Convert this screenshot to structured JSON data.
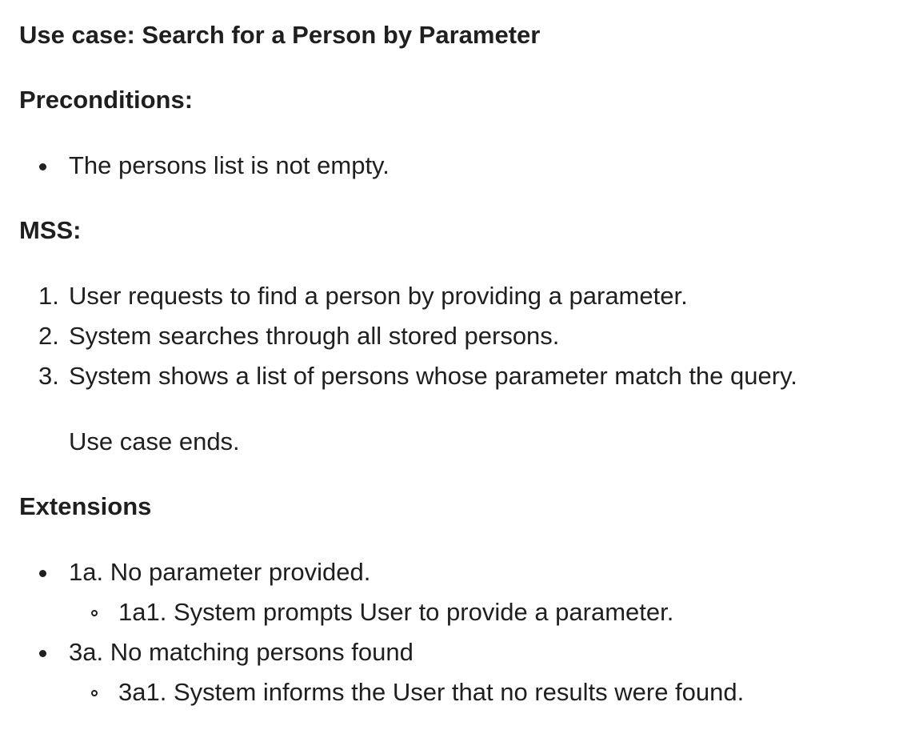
{
  "use_case": {
    "title": "Use case: Search for a Person by Parameter",
    "preconditions_heading": "Preconditions:",
    "preconditions": [
      "The persons list is not empty."
    ],
    "mss_heading": "MSS:",
    "mss_steps": [
      {
        "num": "1.",
        "text": "User requests to find a person by providing a parameter."
      },
      {
        "num": "2.",
        "text": "System searches through all stored persons."
      },
      {
        "num": "3.",
        "text": "System shows a list of persons whose parameter match the query."
      }
    ],
    "mss_end": "Use case ends.",
    "extensions_heading": "Extensions",
    "extensions": [
      {
        "text": "1a. No parameter provided.",
        "sub": [
          "1a1. System prompts User to provide a parameter."
        ]
      },
      {
        "text": "3a. No matching persons found",
        "sub": [
          "3a1. System informs the User that no results were found."
        ]
      }
    ]
  }
}
